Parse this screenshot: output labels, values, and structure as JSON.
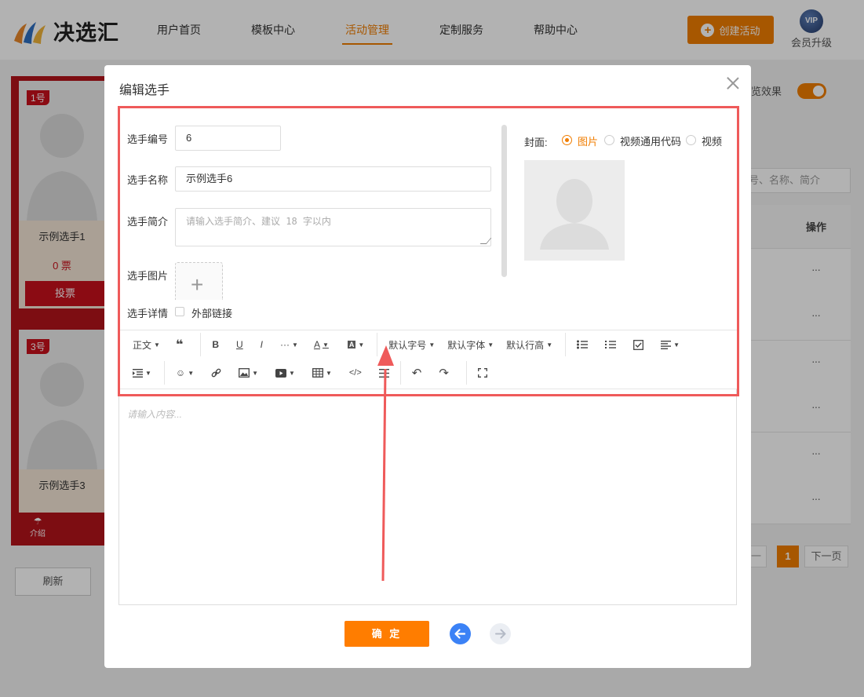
{
  "header": {
    "brand": "决选汇",
    "nav": [
      "用户首页",
      "模板中心",
      "活动管理",
      "定制服务",
      "帮助中心"
    ],
    "active_nav": "活动管理",
    "create_button": "创建活动",
    "vip_badge": "VIP",
    "vip_label": "会员升级"
  },
  "background": {
    "cards": [
      {
        "tag": "1号",
        "name": "示例选手1",
        "votes": "0 票",
        "vote_button": "投票"
      },
      {
        "tag": "3号",
        "name": "示例选手3"
      }
    ],
    "phone_tab": "介绍",
    "refresh_button": "刷新",
    "preview_label": "预览效果",
    "preview_label_visible": "览效果",
    "search_placeholder_visible": "号、名称、简介",
    "op_header_visible": "操作",
    "op_ellipsis": "···",
    "pager_prev_visible": "一页",
    "pager_current": "1",
    "pager_next": "下一页"
  },
  "modal": {
    "title": "编辑选手",
    "fields": {
      "number_label": "选手编号",
      "number_value": "6",
      "name_label": "选手名称",
      "name_value": "示例选手6",
      "intro_label": "选手简介",
      "intro_placeholder": "请输入选手简介、建议 18 字以内",
      "image_label": "选手图片",
      "detail_label": "选手详情",
      "external_link_label": "外部链接"
    },
    "cover": {
      "label": "封面:",
      "options": [
        "图片",
        "视频通用代码",
        "视频"
      ],
      "selected": "图片"
    },
    "toolbar": {
      "paragraph": "正文",
      "font_size": "默认字号",
      "font_family": "默认字体",
      "line_height": "默认行高",
      "more": "···"
    },
    "editor_placeholder": "请输入内容...",
    "confirm_button": "确 定"
  },
  "colors": {
    "accent": "#f07d00",
    "highlight": "#ef5a5a",
    "nav_back": "#3b82f6"
  }
}
